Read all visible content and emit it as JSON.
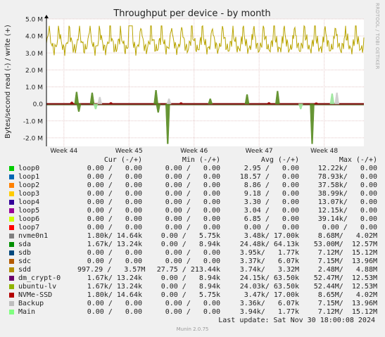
{
  "chart_data": {
    "type": "line",
    "title": "Throughput per device - by month",
    "ylabel": "Bytes/second read (-) / write (+)",
    "ylim": [
      -2500000,
      5000000
    ],
    "yticks": [
      {
        "v": 5000000,
        "label": "5.0 M"
      },
      {
        "v": 4000000,
        "label": "4.0 M"
      },
      {
        "v": 3000000,
        "label": "3.0 M"
      },
      {
        "v": 2000000,
        "label": "2.0 M"
      },
      {
        "v": 1000000,
        "label": "1.0 M"
      },
      {
        "v": 0,
        "label": "0.0"
      },
      {
        "v": -1000000,
        "label": "-1.0 M"
      },
      {
        "v": -2000000,
        "label": "-2.0 M"
      }
    ],
    "xlim": [
      0,
      100
    ],
    "xticks": [
      {
        "x": 5.5,
        "label": "Week 44"
      },
      {
        "x": 26.0,
        "label": "Week 45"
      },
      {
        "x": 46.5,
        "label": "Week 46"
      },
      {
        "x": 67.0,
        "label": "Week 47"
      },
      {
        "x": 87.5,
        "label": "Week 48"
      }
    ],
    "grid": true,
    "series": [
      {
        "name": "sdd",
        "color": "#b8a400",
        "kind": "write-baseline",
        "level": 3570000,
        "amp": 700000,
        "peak": 4600000
      },
      {
        "name": "sda",
        "color": "#568a1f",
        "kind": "spikes",
        "spikes": [
          [
            9.5,
            700000
          ],
          [
            10.2,
            -450000
          ],
          [
            14.4,
            650000
          ],
          [
            34.5,
            800000
          ],
          [
            35.2,
            -500000
          ],
          [
            38.2,
            -2350000
          ],
          [
            51.6,
            300000
          ],
          [
            63.2,
            550000
          ],
          [
            72.8,
            750000
          ],
          [
            83.7,
            -2350000
          ]
        ]
      },
      {
        "name": "nvme0n1",
        "color": "#990000",
        "kind": "spikes",
        "spikes": [
          [
            8.0,
            120000
          ],
          [
            20.3,
            90000
          ],
          [
            42.4,
            80000
          ],
          [
            70.1,
            90000
          ],
          [
            85.0,
            70000
          ]
        ]
      },
      {
        "name": "Main",
        "color": "#99e699",
        "kind": "spikes",
        "spikes": [
          [
            90.0,
            600000
          ],
          [
            15.5,
            -300000
          ],
          [
            80.1,
            -300000
          ]
        ]
      },
      {
        "name": "Backup",
        "color": "#cccccc",
        "kind": "spikes",
        "spikes": [
          [
            16.8,
            400000
          ],
          [
            38.6,
            300000
          ],
          [
            91.5,
            650000
          ]
        ]
      }
    ]
  },
  "side_label": "RRDTOOL / TOBI OETIKER",
  "legend": {
    "headers": {
      "cur": "Cur (-/+)",
      "min": "Min (-/+)",
      "avg": "Avg (-/+)",
      "max": "Max (-/+)"
    },
    "rows": [
      {
        "name": "loop0",
        "color": "#00cc00",
        "cur": "0.00 /   0.00",
        "min": "0.00 /   0.00",
        "avg": "2.95 /   0.00",
        "max": "12.22k/   0.00"
      },
      {
        "name": "loop1",
        "color": "#0066b3",
        "cur": "0.00 /   0.00",
        "min": "0.00 /   0.00",
        "avg": "18.57 /   0.00",
        "max": "78.93k/   0.00"
      },
      {
        "name": "loop2",
        "color": "#ff8000",
        "cur": "0.00 /   0.00",
        "min": "0.00 /   0.00",
        "avg": "8.86 /   0.00",
        "max": "37.58k/   0.00"
      },
      {
        "name": "loop3",
        "color": "#ffcc00",
        "cur": "0.00 /   0.00",
        "min": "0.00 /   0.00",
        "avg": "9.18 /   0.00",
        "max": "38.99k/   0.00"
      },
      {
        "name": "loop4",
        "color": "#330099",
        "cur": "0.00 /   0.00",
        "min": "0.00 /   0.00",
        "avg": "3.30 /   0.00",
        "max": "13.07k/   0.00"
      },
      {
        "name": "loop5",
        "color": "#990099",
        "cur": "0.00 /   0.00",
        "min": "0.00 /   0.00",
        "avg": "3.04 /   0.00",
        "max": "12.15k/   0.00"
      },
      {
        "name": "loop6",
        "color": "#ccff00",
        "cur": "0.00 /   0.00",
        "min": "0.00 /   0.00",
        "avg": "6.85 /   0.00",
        "max": "39.14k/   0.00"
      },
      {
        "name": "loop7",
        "color": "#ff0000",
        "cur": "0.00 /   0.00",
        "min": "0.00 /   0.00",
        "avg": "0.00 /   0.00",
        "max": "0.00 /   0.00"
      },
      {
        "name": "nvme0n1",
        "color": "#808080",
        "cur": "1.80k/ 14.64k",
        "min": "0.00 /   5.75k",
        "avg": "3.48k/ 17.00k",
        "max": "8.68M/   4.02M"
      },
      {
        "name": "sda",
        "color": "#008f00",
        "cur": "1.67k/ 13.24k",
        "min": "0.00 /   8.94k",
        "avg": "24.48k/ 64.13k",
        "max": "53.00M/  12.57M"
      },
      {
        "name": "sdb",
        "color": "#00487d",
        "cur": "0.00 /   0.00",
        "min": "0.00 /   0.00",
        "avg": "3.95k/   1.77k",
        "max": "7.12M/  15.12M"
      },
      {
        "name": "sdc",
        "color": "#b35a00",
        "cur": "0.00 /   0.00",
        "min": "0.00 /   0.00",
        "avg": "3.37k/   6.07k",
        "max": "7.15M/  13.96M"
      },
      {
        "name": "sdd",
        "color": "#b38f00",
        "cur": "997.29 /   3.57M",
        "min": "27.75 / 213.44k",
        "avg": "3.74k/   3.32M",
        "max": "2.48M/   4.88M"
      },
      {
        "name": "dm_crypt-0",
        "color": "#6b006b",
        "cur": "1.67k/ 13.24k",
        "min": "0.00 /   8.94k",
        "avg": "24.15k/ 63.50k",
        "max": "52.47M/  12.53M"
      },
      {
        "name": "ubuntu-lv",
        "color": "#8fb300",
        "cur": "1.67k/ 13.24k",
        "min": "0.00 /   8.94k",
        "avg": "24.03k/ 63.50k",
        "max": "52.44M/  12.53M"
      },
      {
        "name": "NVMe-SSD",
        "color": "#b30000",
        "cur": "1.80k/ 14.64k",
        "min": "0.00 /   5.75k",
        "avg": "3.47k/ 17.00k",
        "max": "8.65M/   4.02M"
      },
      {
        "name": "Backup",
        "color": "#bebebe",
        "cur": "0.00 /   0.00",
        "min": "0.00 /   0.00",
        "avg": "3.36k/   6.07k",
        "max": "7.15M/  13.96M"
      },
      {
        "name": "Main",
        "color": "#80ff80",
        "cur": "0.00 /   0.00",
        "min": "0.00 /   0.00",
        "avg": "3.94k/   1.77k",
        "max": "7.12M/  15.12M"
      }
    ]
  },
  "footer": {
    "last_update": "Last update: Sat Nov 30 18:00:08 2024",
    "munin": "Munin 2.0.75"
  }
}
